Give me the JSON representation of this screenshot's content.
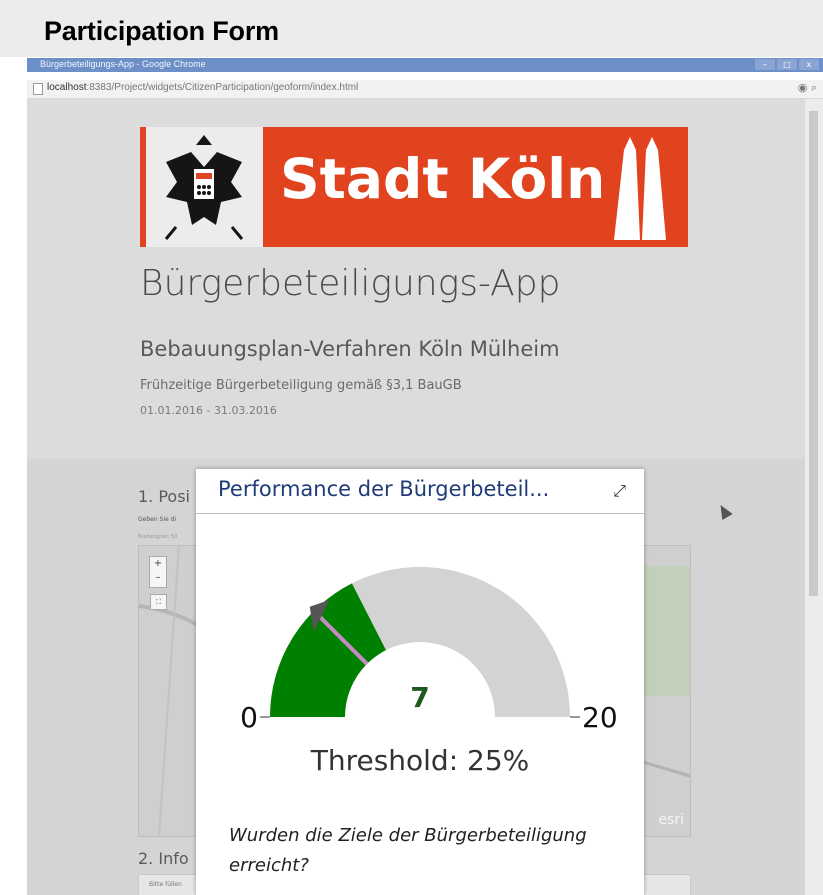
{
  "header": {
    "title": "Participation Form"
  },
  "browser": {
    "window_title": "Bürgerbeteiligungs-App - Google Chrome",
    "url_host": "localhost",
    "url_rest": ":8383/Project/widgets/CitizenParticipation/geoform/index.html",
    "win_min": "–",
    "win_max": "□",
    "win_close": "x",
    "addr_icons": "◉ ⌕"
  },
  "page": {
    "logo_text": "Stadt Köln",
    "app_title": "Bürgerbeteiligungs-App",
    "subtitle": "Bebauungsplan-Verfahren Köln Mülheim",
    "subtitle2": "Frühzeitige Bürgerbeteiligung gemäß §3,1 BauGB",
    "dates": "01.01.2016 - 31.03.2016",
    "step1": "1. Posi",
    "step1_hint": "Geben Sie di",
    "step1_hint2": "Breitengrad: 50",
    "step2": "2. Info",
    "info_hint": "Bitte füllen",
    "map_attrib": "esri",
    "map_zoom_in": "+",
    "map_zoom_out": "–",
    "map_fullscreen": "⛶"
  },
  "popup": {
    "title": "Performance der Bürgerbeteil...",
    "expand_icon": "expand-icon",
    "expand_glyph": "⤢",
    "gauge": {
      "value": 7,
      "min": 0,
      "max": 20,
      "threshold_fraction": 0.25,
      "value_color": "#008000",
      "track_color": "#d3d3d3",
      "threshold_color": "#c58bc5"
    },
    "value_label": "7",
    "min_label": "0",
    "max_label": "20",
    "threshold_text": "Threshold: 25%",
    "question": "Wurden die Ziele der Bürgerbeteiligung erreicht?"
  }
}
